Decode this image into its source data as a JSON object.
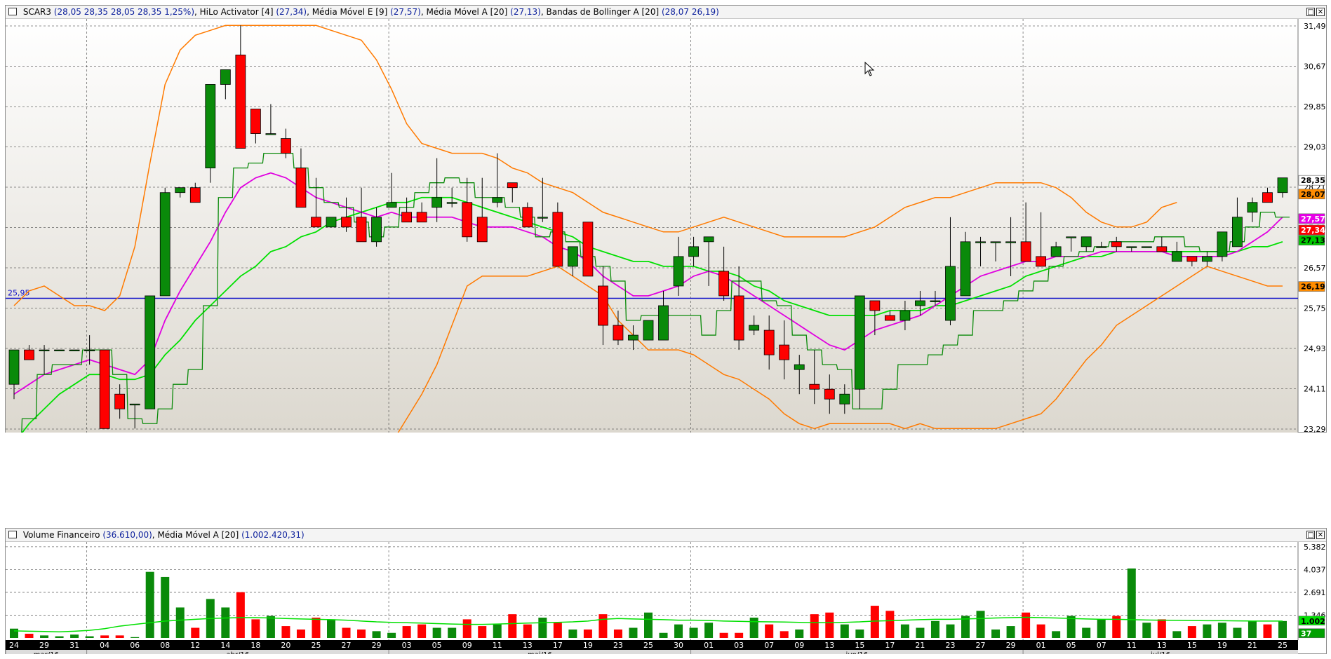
{
  "price_panel": {
    "symbol": "SCAR3",
    "symbol_values": "(28,05  28,35  28,05  28,35  1,25%)",
    "ind1_name": "HiLo Activator [4]",
    "ind1_value": "(27,34)",
    "ind2_name": "Média Móvel E [9]",
    "ind2_value": "(27,57)",
    "ind3_name": "Média Móvel A [20]",
    "ind3_value": "(27,13)",
    "ind4_name": "Bandas de Bollinger A [20]",
    "ind4_value": "(28,07  26,19)",
    "hline_label": "25,95",
    "y_ticks": [
      "31,49",
      "30,67",
      "29,85",
      "29,03",
      "28,21",
      "27,39",
      "26,57",
      "25,75",
      "24,93",
      "24,11",
      "23,29"
    ],
    "value_tags": [
      {
        "text": "28,35",
        "bg": "#ffffff",
        "fg": "#000000",
        "y": 28.35
      },
      {
        "text": "28,07",
        "bg": "#ff8c00",
        "fg": "#000000",
        "y": 28.07
      },
      {
        "text": "27,57",
        "bg": "#e800e8",
        "fg": "#ffffff",
        "y": 27.57
      },
      {
        "text": "27,34",
        "bg": "#ff0000",
        "fg": "#ffffff",
        "y": 27.34
      },
      {
        "text": "27,13",
        "bg": "#00c800",
        "fg": "#000000",
        "y": 27.13
      },
      {
        "text": "26,19",
        "bg": "#ff8c00",
        "fg": "#000000",
        "y": 26.19
      }
    ]
  },
  "volume_panel": {
    "name": "Volume Financeiro",
    "value": "(36.610,00)",
    "ma_name": "Média Móvel A [20]",
    "ma_value": "(1.002.420,31)",
    "y_ticks": [
      "5.382",
      "4.037",
      "2.691",
      "1.346"
    ],
    "tag_ma": "1.002",
    "tag_vol": "37"
  },
  "x_axis": {
    "day_labels": [
      "24",
      "29",
      "31",
      "04",
      "06",
      "08",
      "12",
      "14",
      "18",
      "20",
      "25",
      "27",
      "29",
      "03",
      "05",
      "09",
      "11",
      "13",
      "17",
      "19",
      "23",
      "25",
      "30",
      "01",
      "03",
      "07",
      "09",
      "13",
      "15",
      "17",
      "21",
      "23",
      "27",
      "29",
      "01",
      "05",
      "07",
      "11",
      "13",
      "15",
      "19",
      "21",
      "25"
    ],
    "months": [
      {
        "label": "mar/16",
        "start": 0,
        "end": 5
      },
      {
        "label": "abr/16",
        "start": 5,
        "end": 25
      },
      {
        "label": "mai/16",
        "start": 25,
        "end": 45
      },
      {
        "label": "jun/16",
        "start": 45,
        "end": 67
      },
      {
        "label": "jul/16",
        "start": 67,
        "end": 85
      }
    ]
  },
  "chart_data": {
    "type": "candlestick",
    "y_range": [
      23.29,
      31.49
    ],
    "series": [
      {
        "name": "SCAR3",
        "kind": "ohlc",
        "columns": [
          "open",
          "high",
          "low",
          "close"
        ],
        "values": [
          [
            24.2,
            24.6,
            23.9,
            24.9
          ],
          [
            24.9,
            25.0,
            24.9,
            24.7
          ],
          [
            24.9,
            25.0,
            24.4,
            24.9
          ],
          [
            24.9,
            24.9,
            24.9,
            24.9
          ],
          [
            24.9,
            24.9,
            24.9,
            24.9
          ],
          [
            24.9,
            25.2,
            24.6,
            24.9
          ],
          [
            24.9,
            24.9,
            23.3,
            23.3
          ],
          [
            24.0,
            24.2,
            23.5,
            23.7
          ],
          [
            23.8,
            23.8,
            23.3,
            23.8
          ],
          [
            23.7,
            26.0,
            23.7,
            26.0
          ],
          [
            26.0,
            28.2,
            26.0,
            28.1
          ],
          [
            28.1,
            28.2,
            28.0,
            28.2
          ],
          [
            28.2,
            28.3,
            27.9,
            27.9
          ],
          [
            28.6,
            28.6,
            28.3,
            30.3
          ],
          [
            30.3,
            30.5,
            30.0,
            30.6
          ],
          [
            30.9,
            31.5,
            30.7,
            29.0
          ],
          [
            29.8,
            29.8,
            29.1,
            29.3
          ],
          [
            29.3,
            29.9,
            29.3,
            29.3
          ],
          [
            29.2,
            29.4,
            28.8,
            28.9
          ],
          [
            28.6,
            29.0,
            27.8,
            27.8
          ],
          [
            27.6,
            28.4,
            27.4,
            27.4
          ],
          [
            27.4,
            27.6,
            27.6,
            27.6
          ],
          [
            27.6,
            28.0,
            27.3,
            27.4
          ],
          [
            27.6,
            28.2,
            27.1,
            27.1
          ],
          [
            27.1,
            27.8,
            27.0,
            27.6
          ],
          [
            27.8,
            28.5,
            27.8,
            27.9
          ],
          [
            27.7,
            28.0,
            27.5,
            27.5
          ],
          [
            27.7,
            27.9,
            27.5,
            27.5
          ],
          [
            27.8,
            28.8,
            27.5,
            28.0
          ],
          [
            27.9,
            28.2,
            27.8,
            27.9
          ],
          [
            27.9,
            28.4,
            27.1,
            27.2
          ],
          [
            27.6,
            28.4,
            27.1,
            27.1
          ],
          [
            27.9,
            28.9,
            27.8,
            28.0
          ],
          [
            28.3,
            28.3,
            27.9,
            28.2
          ],
          [
            27.8,
            27.9,
            27.4,
            27.4
          ],
          [
            27.6,
            28.4,
            27.5,
            27.6
          ],
          [
            27.7,
            27.9,
            26.6,
            26.6
          ],
          [
            26.6,
            26.8,
            26.4,
            27.0
          ],
          [
            27.5,
            27.5,
            26.4,
            26.4
          ],
          [
            26.2,
            26.6,
            25.0,
            25.4
          ],
          [
            25.4,
            25.7,
            25.0,
            25.1
          ],
          [
            25.1,
            25.4,
            24.9,
            25.2
          ],
          [
            25.1,
            25.4,
            25.1,
            25.5
          ],
          [
            25.1,
            26.1,
            25.1,
            25.8
          ],
          [
            26.2,
            27.2,
            26.0,
            26.8
          ],
          [
            26.8,
            27.2,
            26.6,
            27.0
          ],
          [
            27.1,
            27.2,
            26.2,
            27.2
          ],
          [
            26.5,
            27.0,
            25.9,
            26.0
          ],
          [
            26.0,
            26.6,
            24.9,
            25.1
          ],
          [
            25.3,
            25.6,
            25.2,
            25.4
          ],
          [
            25.3,
            25.6,
            24.5,
            24.8
          ],
          [
            25.0,
            25.5,
            24.3,
            24.7
          ],
          [
            24.5,
            24.8,
            24.0,
            24.6
          ],
          [
            24.2,
            24.9,
            23.8,
            24.1
          ],
          [
            24.1,
            24.4,
            23.6,
            23.9
          ],
          [
            23.8,
            24.2,
            23.6,
            24.0
          ],
          [
            24.1,
            26.0,
            23.7,
            26.0
          ],
          [
            25.9,
            25.8,
            25.2,
            25.7
          ],
          [
            25.6,
            25.7,
            25.5,
            25.5
          ],
          [
            25.5,
            25.9,
            25.3,
            25.7
          ],
          [
            25.8,
            26.1,
            25.6,
            25.9
          ],
          [
            25.9,
            26.1,
            25.8,
            25.9
          ],
          [
            25.5,
            27.6,
            25.4,
            26.6
          ],
          [
            26.0,
            27.3,
            26.0,
            27.1
          ],
          [
            27.1,
            27.2,
            26.6,
            27.1
          ],
          [
            27.1,
            27.1,
            26.7,
            27.1
          ],
          [
            27.1,
            27.6,
            26.4,
            27.1
          ],
          [
            27.1,
            27.9,
            27.1,
            26.7
          ],
          [
            26.8,
            27.7,
            26.7,
            26.6
          ],
          [
            26.8,
            27.1,
            26.8,
            27.0
          ],
          [
            27.2,
            27.2,
            26.9,
            27.2
          ],
          [
            27.0,
            27.2,
            26.9,
            27.2
          ],
          [
            27.0,
            27.1,
            27.0,
            27.0
          ],
          [
            27.1,
            27.2,
            26.9,
            27.0
          ],
          [
            27.0,
            27.0,
            26.9,
            27.0
          ],
          [
            27.0,
            27.0,
            27.0,
            27.0
          ],
          [
            27.0,
            27.2,
            27.0,
            26.9
          ],
          [
            26.7,
            27.1,
            26.7,
            26.9
          ],
          [
            26.8,
            26.8,
            26.6,
            26.7
          ],
          [
            26.7,
            26.9,
            26.6,
            26.8
          ],
          [
            26.8,
            27.2,
            26.7,
            27.3
          ],
          [
            27.0,
            28.0,
            27.0,
            27.6
          ],
          [
            27.7,
            28.0,
            27.5,
            27.9
          ],
          [
            28.1,
            28.2,
            28.0,
            27.9
          ],
          [
            28.1,
            28.2,
            28.0,
            28.4
          ]
        ]
      }
    ],
    "indicators": {
      "ema9": [
        24.0,
        24.2,
        24.4,
        24.5,
        24.6,
        24.7,
        24.6,
        24.5,
        24.4,
        24.7,
        25.5,
        26.1,
        26.6,
        27.1,
        27.7,
        28.2,
        28.4,
        28.5,
        28.4,
        28.2,
        28.0,
        27.9,
        27.8,
        27.7,
        27.6,
        27.7,
        27.6,
        27.6,
        27.6,
        27.6,
        27.5,
        27.4,
        27.4,
        27.4,
        27.3,
        27.2,
        27.0,
        26.9,
        26.7,
        26.4,
        26.2,
        26.0,
        26.0,
        26.1,
        26.2,
        26.4,
        26.5,
        26.4,
        26.2,
        26.0,
        25.8,
        25.6,
        25.4,
        25.2,
        25.0,
        24.9,
        25.1,
        25.3,
        25.4,
        25.5,
        25.6,
        25.8,
        26.0,
        26.2,
        26.4,
        26.5,
        26.6,
        26.7,
        26.7,
        26.8,
        26.8,
        26.8,
        26.9,
        26.9,
        26.9,
        26.9,
        26.9,
        26.8,
        26.8,
        26.8,
        26.8,
        26.9,
        27.1,
        27.3,
        27.6
      ],
      "sma20": [
        23.0,
        23.4,
        23.7,
        24.0,
        24.2,
        24.4,
        24.4,
        24.3,
        24.3,
        24.4,
        24.8,
        25.1,
        25.5,
        25.8,
        26.1,
        26.4,
        26.6,
        26.9,
        27.0,
        27.2,
        27.3,
        27.5,
        27.6,
        27.7,
        27.8,
        27.9,
        27.9,
        28.0,
        28.0,
        28.0,
        27.9,
        27.8,
        27.7,
        27.6,
        27.5,
        27.4,
        27.3,
        27.2,
        27.0,
        26.9,
        26.8,
        26.7,
        26.7,
        26.6,
        26.6,
        26.6,
        26.5,
        26.5,
        26.4,
        26.2,
        26.1,
        25.9,
        25.8,
        25.7,
        25.6,
        25.6,
        25.6,
        25.6,
        25.7,
        25.7,
        25.7,
        25.8,
        25.8,
        25.9,
        26.0,
        26.1,
        26.2,
        26.4,
        26.5,
        26.6,
        26.7,
        26.8,
        26.8,
        26.9,
        26.9,
        26.9,
        26.9,
        26.9,
        26.9,
        26.9,
        26.9,
        26.9,
        27.0,
        27.0,
        27.1
      ],
      "hilo": [
        22.9,
        23.5,
        24.4,
        24.6,
        24.6,
        24.9,
        24.9,
        24.4,
        23.5,
        23.4,
        23.7,
        24.2,
        24.5,
        25.8,
        28.0,
        28.6,
        28.7,
        28.9,
        28.9,
        28.6,
        28.2,
        27.9,
        27.8,
        27.5,
        27.2,
        27.4,
        27.8,
        28.1,
        28.3,
        28.4,
        28.3,
        28.0,
        28.0,
        27.8,
        27.6,
        27.2,
        27.3,
        27.1,
        26.8,
        26.6,
        26.3,
        25.5,
        25.6,
        25.6,
        25.6,
        25.6,
        25.2,
        25.7,
        26.3,
        26.3,
        25.9,
        25.8,
        25.2,
        24.9,
        24.6,
        24.5,
        23.7,
        23.7,
        24.1,
        24.6,
        24.6,
        24.8,
        25.0,
        25.2,
        25.7,
        25.7,
        25.9,
        26.1,
        26.3,
        26.6,
        26.8,
        26.9,
        27.0,
        27.1,
        27.1,
        27.1,
        27.2,
        27.2,
        27.0,
        26.9,
        26.9,
        27.1,
        27.4,
        27.7,
        27.6
      ],
      "bb_upper": [
        25.8,
        26.1,
        26.2,
        26.0,
        25.8,
        25.8,
        25.7,
        26.0,
        27.0,
        28.7,
        30.3,
        31.0,
        31.3,
        31.4,
        31.5,
        31.5,
        31.5,
        31.5,
        31.5,
        31.5,
        31.5,
        31.4,
        31.3,
        31.2,
        30.8,
        30.2,
        29.5,
        29.1,
        29.0,
        28.9,
        28.9,
        28.9,
        28.8,
        28.6,
        28.5,
        28.3,
        28.2,
        28.1,
        27.9,
        27.7,
        27.6,
        27.5,
        27.4,
        27.3,
        27.3,
        27.4,
        27.5,
        27.6,
        27.5,
        27.4,
        27.3,
        27.2,
        27.2,
        27.2,
        27.2,
        27.2,
        27.3,
        27.4,
        27.6,
        27.8,
        27.9,
        28.0,
        28.0,
        28.1,
        28.2,
        28.3,
        28.3,
        28.3,
        28.3,
        28.2,
        28.0,
        27.7,
        27.5,
        27.4,
        27.4,
        27.5,
        27.8,
        27.9
      ],
      "bb_lower": [
        21.0,
        21.2,
        21.3,
        21.5,
        21.8,
        22.0,
        22.2,
        22.5,
        23.0,
        23.5,
        24.0,
        24.6,
        25.4,
        26.2,
        26.4,
        26.4,
        26.4,
        26.4,
        26.5,
        26.6,
        26.4,
        26.2,
        26.0,
        25.5,
        25.2,
        24.9,
        24.9,
        24.9,
        24.8,
        24.6,
        24.4,
        24.3,
        24.1,
        23.9,
        23.6,
        23.4,
        23.3,
        23.4,
        23.4,
        23.4,
        23.4,
        23.4,
        23.3,
        23.4,
        23.3,
        23.3,
        23.3,
        23.3,
        23.3,
        23.4,
        23.5,
        23.6,
        23.9,
        24.3,
        24.7,
        25.0,
        25.4,
        25.6,
        25.8,
        26.0,
        26.2,
        26.4,
        26.6,
        26.5,
        26.4,
        26.3,
        26.2,
        26.2
      ]
    },
    "volume_ma": [
      0.42,
      0.4,
      0.38,
      0.36,
      0.4,
      0.45,
      0.55,
      0.7,
      0.8,
      0.9,
      1.0,
      1.05,
      1.1,
      1.15,
      1.18,
      1.2,
      1.2,
      1.18,
      1.15,
      1.12,
      1.1,
      1.08,
      1.05,
      1.0,
      0.95,
      0.92,
      0.9,
      0.88,
      0.85,
      0.82,
      0.8,
      0.8,
      0.82,
      0.85,
      0.88,
      0.9,
      0.92,
      0.95,
      1.0,
      1.1,
      1.15,
      1.12,
      1.1,
      1.08,
      1.05,
      1.05,
      1.03,
      1.0,
      0.98,
      0.96,
      0.95,
      0.94,
      0.92,
      0.9,
      0.9,
      0.92,
      0.95,
      1.0,
      1.02,
      1.05,
      1.08,
      1.1,
      1.1,
      1.12,
      1.15,
      1.18,
      1.2,
      1.22,
      1.2,
      1.18,
      1.15,
      1.12,
      1.1,
      1.1,
      1.08,
      1.06,
      1.05,
      1.04,
      1.03,
      1.02,
      1.02,
      1.01,
      1.0,
      1.0,
      1.0
    ],
    "volume": [
      0.55,
      0.25,
      0.15,
      0.1,
      0.2,
      0.1,
      0.15,
      0.15,
      0.05,
      3.9,
      3.6,
      1.8,
      0.6,
      2.3,
      1.8,
      2.7,
      1.1,
      1.3,
      0.7,
      0.5,
      1.2,
      1.1,
      0.6,
      0.5,
      0.4,
      0.3,
      0.7,
      0.8,
      0.6,
      0.6,
      1.1,
      0.7,
      0.8,
      1.4,
      0.8,
      1.2,
      0.9,
      0.5,
      0.5,
      1.4,
      0.5,
      0.6,
      1.5,
      0.3,
      0.8,
      0.6,
      0.9,
      0.3,
      0.3,
      1.2,
      0.8,
      0.4,
      0.5,
      1.4,
      1.5,
      0.8,
      0.5,
      1.9,
      1.6,
      0.8,
      0.6,
      1.0,
      0.8,
      1.3,
      1.6,
      0.5,
      0.7,
      1.5,
      0.8,
      0.4,
      1.3,
      0.6,
      1.1,
      1.3,
      4.1,
      0.9,
      1.1,
      0.4,
      0.7,
      0.8,
      0.9,
      0.6,
      1.0,
      0.8,
      1.0
    ],
    "ylim_volume": [
      0,
      5.5
    ]
  }
}
